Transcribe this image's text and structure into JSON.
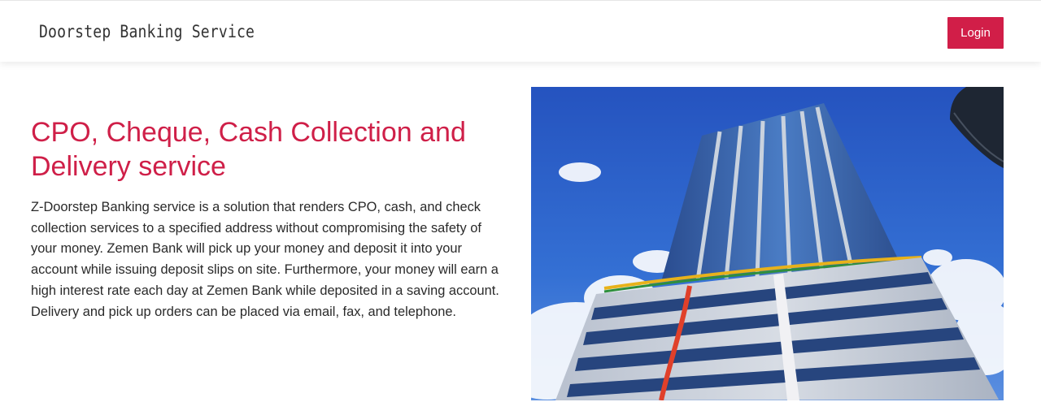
{
  "navbar": {
    "brand": "Doorstep Banking Service",
    "login_label": "Login"
  },
  "hero": {
    "headline": "CPO, Cheque, Cash Collection and Delivery service",
    "description": "Z-Doorstep Banking service is a solution that renders CPO, cash, and check collection services to a specified address without compromising the safety of your money. Zemen Bank will pick up your money and deposit it into your account while issuing deposit slips on site. Furthermore, your money will earn a high interest rate each day at Zemen Bank while deposited in a saving account. Delivery and pick up orders can be placed via email, fax, and telephone.",
    "image": {
      "subject": "zemen-bank-tower-photo"
    }
  },
  "colors": {
    "accent": "#d11e48",
    "headline": "#cf1f48",
    "text": "#2a2a2a",
    "sky": "#2f63c9"
  }
}
